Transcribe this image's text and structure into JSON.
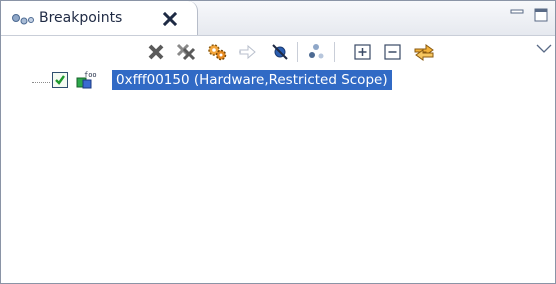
{
  "view": {
    "title": "Breakpoints",
    "icons": {
      "tab_icon": "breakpoints-view-icon",
      "close": "close-icon",
      "minimize": "minimize-icon",
      "maximize": "maximize-icon"
    }
  },
  "toolbar": {
    "buttons": [
      {
        "name": "remove-breakpoint",
        "icon": "remove-icon"
      },
      {
        "name": "remove-all-breakpoints",
        "icon": "remove-all-icon"
      },
      {
        "name": "show-supported-breakpoints",
        "icon": "gears-icon"
      },
      {
        "name": "go-to-file",
        "icon": "arrow-right-icon"
      },
      {
        "name": "skip-all-breakpoints",
        "icon": "skip-breakpoints-icon"
      },
      {
        "name": "group-by",
        "icon": "group-icon"
      },
      {
        "name": "expand-all",
        "icon": "expand-all-icon"
      },
      {
        "name": "collapse-all",
        "icon": "collapse-all-icon"
      },
      {
        "name": "link-with-debug-view",
        "icon": "link-icon"
      },
      {
        "name": "view-menu",
        "icon": "chevron-down-icon"
      }
    ]
  },
  "breakpoints": [
    {
      "label": "0xfff00150  (Hardware,Restricted Scope)",
      "enabled": true,
      "icon": "hardware-breakpoint-icon",
      "selected": true
    }
  ],
  "colors": {
    "selection": "#316ac5",
    "selection_text": "#ffffff",
    "accent_orange": "#f0a020"
  }
}
